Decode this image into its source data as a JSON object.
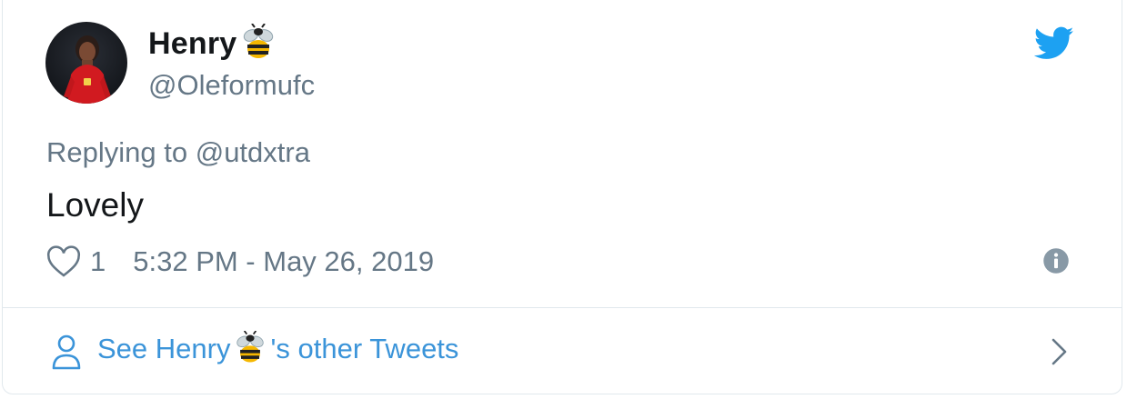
{
  "user": {
    "display_name": "Henry",
    "handle": "@Oleformufc"
  },
  "icons": {
    "name_emoji": "bee-emoji",
    "brand": "twitter-bird-icon",
    "like": "heart-icon",
    "info": "info-icon",
    "profile": "person-icon",
    "more": "chevron-right-icon"
  },
  "reply": {
    "prefix": "Replying to",
    "mention": "@utdxtra"
  },
  "tweet": {
    "text": "Lovely",
    "like_count": "1",
    "timestamp": "5:32 PM - May 26, 2019"
  },
  "footer": {
    "link_prefix": "See Henry",
    "link_suffix": "'s other Tweets"
  },
  "colors": {
    "brand_blue": "#1da1f2",
    "link_blue": "#3b94d9",
    "secondary_text": "#657786",
    "primary_text": "#14171a",
    "border": "#e1e8ed"
  }
}
